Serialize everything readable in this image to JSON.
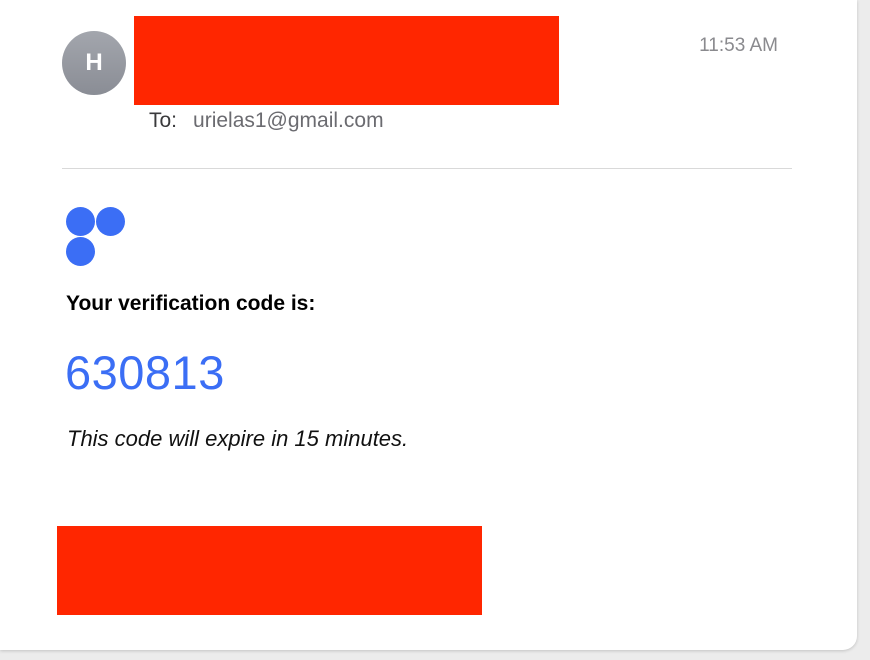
{
  "email": {
    "avatar_initial": "H",
    "time": "11:53 AM",
    "to_label": "To:",
    "to_address": "urielas1@gmail.com"
  },
  "body": {
    "logo_icon": "brand-dots-logo",
    "headline": "Your verification code is:",
    "code": "630813",
    "expiry_note": "This code will expire in 15 minutes."
  },
  "colors": {
    "accent": "#3b6ef5",
    "redaction": "#ff2600",
    "avatar": "#9a9da4"
  }
}
